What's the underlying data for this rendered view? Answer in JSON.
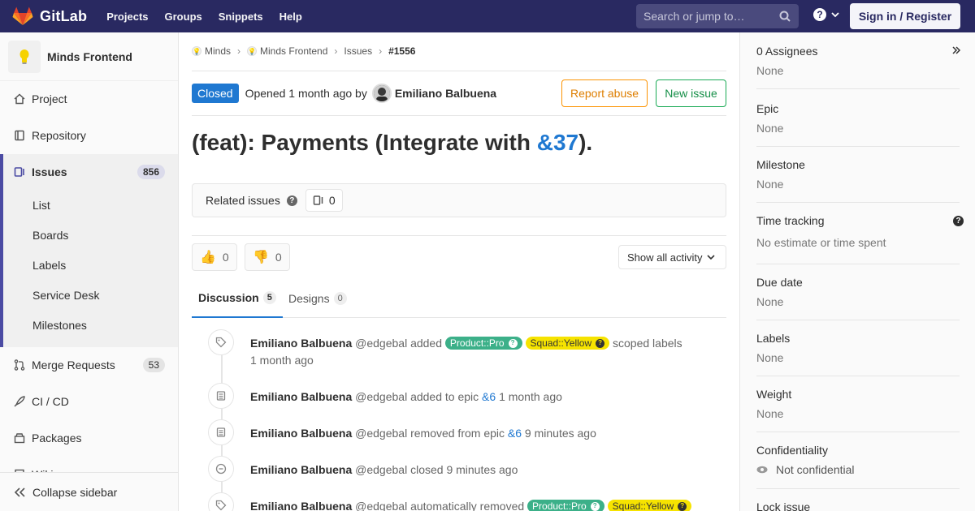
{
  "navbar": {
    "brand": "GitLab",
    "links": [
      "Projects",
      "Groups",
      "Snippets",
      "Help"
    ],
    "search_placeholder": "Search or jump to…",
    "signin": "Sign in / Register"
  },
  "sidebar": {
    "project_name": "Minds Frontend",
    "items": [
      {
        "label": "Project"
      },
      {
        "label": "Repository"
      },
      {
        "label": "Issues",
        "count": "856"
      },
      {
        "label": "Merge Requests",
        "count": "53"
      },
      {
        "label": "CI / CD"
      },
      {
        "label": "Packages"
      },
      {
        "label": "Wiki"
      }
    ],
    "issues_sub": [
      "List",
      "Boards",
      "Labels",
      "Service Desk",
      "Milestones"
    ],
    "collapse": "Collapse sidebar"
  },
  "breadcrumbs": [
    "Minds",
    "Minds Frontend",
    "Issues",
    "#1556"
  ],
  "issue": {
    "status": "Closed",
    "opened": "Opened 1 month ago by",
    "author": "Emiliano Balbuena",
    "report_abuse": "Report abuse",
    "new_issue": "New issue",
    "title_prefix": "(feat): Payments (Integrate with ",
    "title_ref": "&37",
    "title_suffix": ").",
    "related_label": "Related issues",
    "related_count": "0",
    "thumbs_up": "0",
    "thumbs_down": "0",
    "activity_filter": "Show all activity"
  },
  "tabs": [
    {
      "label": "Discussion",
      "count": "5"
    },
    {
      "label": "Designs",
      "count": "0"
    }
  ],
  "notes": [
    {
      "who": "Emiliano Balbuena",
      "handle": "@edgebal",
      "action": "added",
      "labels": [
        "Product::Pro",
        "Squad::Yellow"
      ],
      "tail": "scoped labels",
      "time": "1 month ago",
      "icon": "tag-icon"
    },
    {
      "who": "Emiliano Balbuena",
      "handle": "@edgebal",
      "action": "added to epic",
      "ref": "&6",
      "time": "1 month ago",
      "icon": "epic-icon"
    },
    {
      "who": "Emiliano Balbuena",
      "handle": "@edgebal",
      "action": "removed from epic",
      "ref": "&6",
      "time": "9 minutes ago",
      "icon": "epic-icon"
    },
    {
      "who": "Emiliano Balbuena",
      "handle": "@edgebal",
      "action": "closed",
      "time": "9 minutes ago",
      "icon": "closed-icon"
    },
    {
      "who": "Emiliano Balbuena",
      "handle": "@edgebal",
      "action": "automatically removed",
      "labels": [
        "Product::Pro",
        "Squad::Yellow"
      ],
      "icon": "tag-icon"
    }
  ],
  "right": [
    {
      "title": "0 Assignees",
      "value": "None"
    },
    {
      "title": "Epic",
      "value": "None"
    },
    {
      "title": "Milestone",
      "value": "None"
    },
    {
      "title": "Time tracking",
      "value": "No estimate or time spent"
    },
    {
      "title": "Due date",
      "value": "None"
    },
    {
      "title": "Labels",
      "value": "None"
    },
    {
      "title": "Weight",
      "value": "None"
    },
    {
      "title": "Confidentiality",
      "value": "Not confidential"
    },
    {
      "title": "Lock issue",
      "value": ""
    }
  ],
  "colors": {
    "navbar": "#292961",
    "link": "#1f78d1",
    "closed": "#1f78d1",
    "label_pro": "#3cb089",
    "label_yellow": "#f6e300"
  }
}
